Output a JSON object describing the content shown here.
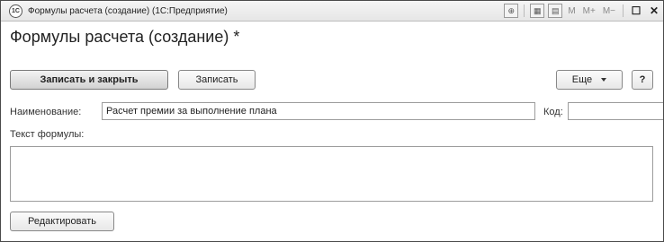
{
  "window": {
    "title": "Формулы расчета (создание) (1С:Предприятие)",
    "icon_text": "1С",
    "toolbar": {
      "m_label": "M",
      "m_plus_label": "M+",
      "m_minus_label": "M−",
      "close_glyph": "✕"
    }
  },
  "form": {
    "title": "Формулы расчета (создание) *",
    "buttons": {
      "save_close": "Записать и закрыть",
      "save": "Записать",
      "more": "Еще",
      "help": "?",
      "edit": "Редактировать"
    },
    "fields": {
      "name_label": "Наименование:",
      "name_value": "Расчет премии за выполнение плана",
      "code_label": "Код:",
      "code_value": "",
      "formula_label": "Текст формулы:",
      "formula_value": ""
    }
  }
}
